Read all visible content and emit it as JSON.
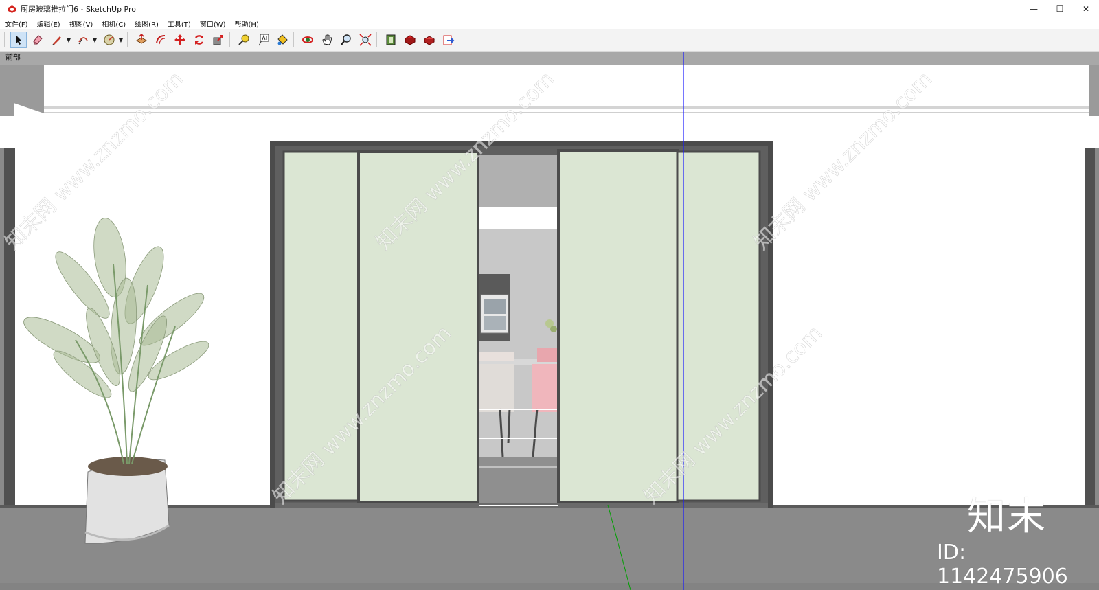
{
  "window": {
    "title": "厨房玻璃推拉门6 - SketchUp Pro",
    "minimize_glyph": "—",
    "maximize_glyph": "☐",
    "close_glyph": "✕"
  },
  "menu": {
    "items": [
      "文件(F)",
      "编辑(E)",
      "视图(V)",
      "相机(C)",
      "绘图(R)",
      "工具(T)",
      "窗口(W)",
      "帮助(H)"
    ]
  },
  "toolbar": {
    "tools": [
      {
        "name": "select-tool",
        "icon": "arrow-icon",
        "active": true
      },
      {
        "name": "eraser-tool",
        "icon": "eraser-icon"
      },
      {
        "name": "line-tool",
        "icon": "pencil-icon",
        "dropdown": true
      },
      {
        "name": "arc-tool",
        "icon": "arc-icon",
        "dropdown": true
      },
      {
        "name": "shape-tool",
        "icon": "circle-icon",
        "dropdown": true
      },
      {
        "name": "push-pull-tool",
        "icon": "push-pull-icon"
      },
      {
        "name": "offset-tool",
        "icon": "offset-icon"
      },
      {
        "name": "move-tool",
        "icon": "move-icon"
      },
      {
        "name": "rotate-tool",
        "icon": "rotate-icon"
      },
      {
        "name": "scale-tool",
        "icon": "scale-icon"
      },
      {
        "name": "tape-measure-tool",
        "icon": "tape-measure-icon"
      },
      {
        "name": "text-tool",
        "icon": "text-icon"
      },
      {
        "name": "paint-bucket-tool",
        "icon": "paint-bucket-icon"
      },
      {
        "name": "orbit-tool",
        "icon": "orbit-icon"
      },
      {
        "name": "pan-tool",
        "icon": "hand-icon"
      },
      {
        "name": "zoom-tool",
        "icon": "magnifier-icon"
      },
      {
        "name": "zoom-extents-tool",
        "icon": "zoom-extents-icon"
      },
      {
        "name": "3d-warehouse-button",
        "icon": "warehouse-icon"
      },
      {
        "name": "extension-warehouse-button",
        "icon": "extension-icon"
      },
      {
        "name": "layout-button",
        "icon": "layout-icon"
      },
      {
        "name": "send-to-layout-button",
        "icon": "send-icon"
      }
    ]
  },
  "viewport": {
    "scene_label": "前部"
  },
  "watermark": {
    "site": "www.znzmo.com",
    "brand": "知末网",
    "logo_text": "知末",
    "id_text": "ID: 1142475906"
  },
  "colors": {
    "glass": "#dbe6d3",
    "frame": "#4b4b4b",
    "floor": "#8a8a8a",
    "axis_blue": "#1a1aff",
    "axis_green": "#00a000"
  }
}
